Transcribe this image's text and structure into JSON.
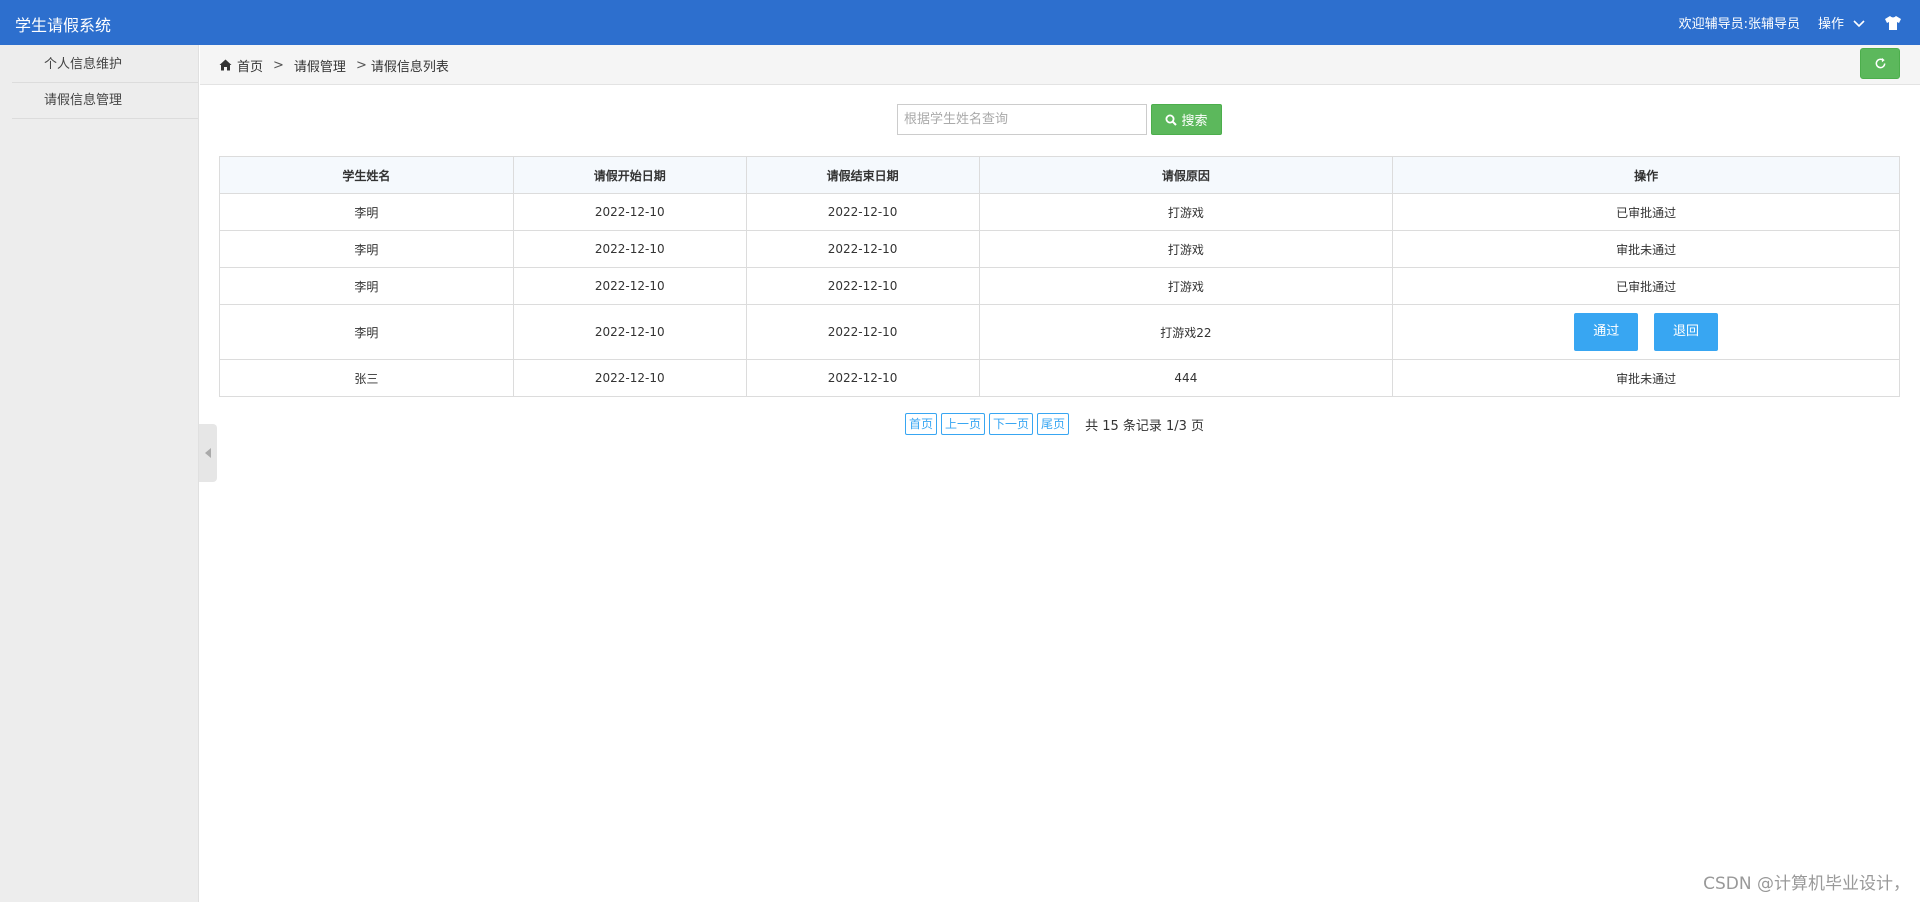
{
  "app": {
    "title": "学生请假系统"
  },
  "topbar": {
    "welcome": "欢迎辅导员:张辅导员",
    "ops_label": "操作"
  },
  "sidebar": {
    "items": [
      {
        "label": "个人信息维护"
      },
      {
        "label": "请假信息管理"
      }
    ]
  },
  "breadcrumb": {
    "home": "首页",
    "sep": ">",
    "level1": "请假管理",
    "level2": "请假信息列表"
  },
  "search": {
    "placeholder": "根据学生姓名查询",
    "value": "",
    "button_label": "搜索"
  },
  "table": {
    "headers": [
      "学生姓名",
      "请假开始日期",
      "请假结束日期",
      "请假原因",
      "操作"
    ],
    "rows": [
      {
        "name": "李明",
        "start": "2022-12-10",
        "end": "2022-12-10",
        "reason": "打游戏",
        "status": "已审批通过"
      },
      {
        "name": "李明",
        "start": "2022-12-10",
        "end": "2022-12-10",
        "reason": "打游戏",
        "status": "审批未通过"
      },
      {
        "name": "李明",
        "start": "2022-12-10",
        "end": "2022-12-10",
        "reason": "打游戏",
        "status": "已审批通过"
      },
      {
        "name": "李明",
        "start": "2022-12-10",
        "end": "2022-12-10",
        "reason": "打游戏22",
        "approve_label": "通过",
        "reject_label": "退回"
      },
      {
        "name": "张三",
        "start": "2022-12-10",
        "end": "2022-12-10",
        "reason": "444",
        "status": "审批未通过"
      }
    ]
  },
  "pager": {
    "first": "首页",
    "prev": "上一页",
    "next": "下一页",
    "last": "尾页",
    "info": "共 15 条记录 1/3 页"
  },
  "watermark": "CSDN @计算机毕业设计，",
  "colors": {
    "topbar": "#2d6fce",
    "success": "#5cb85c",
    "action": "#38a6f2",
    "status": "#ff0000"
  }
}
